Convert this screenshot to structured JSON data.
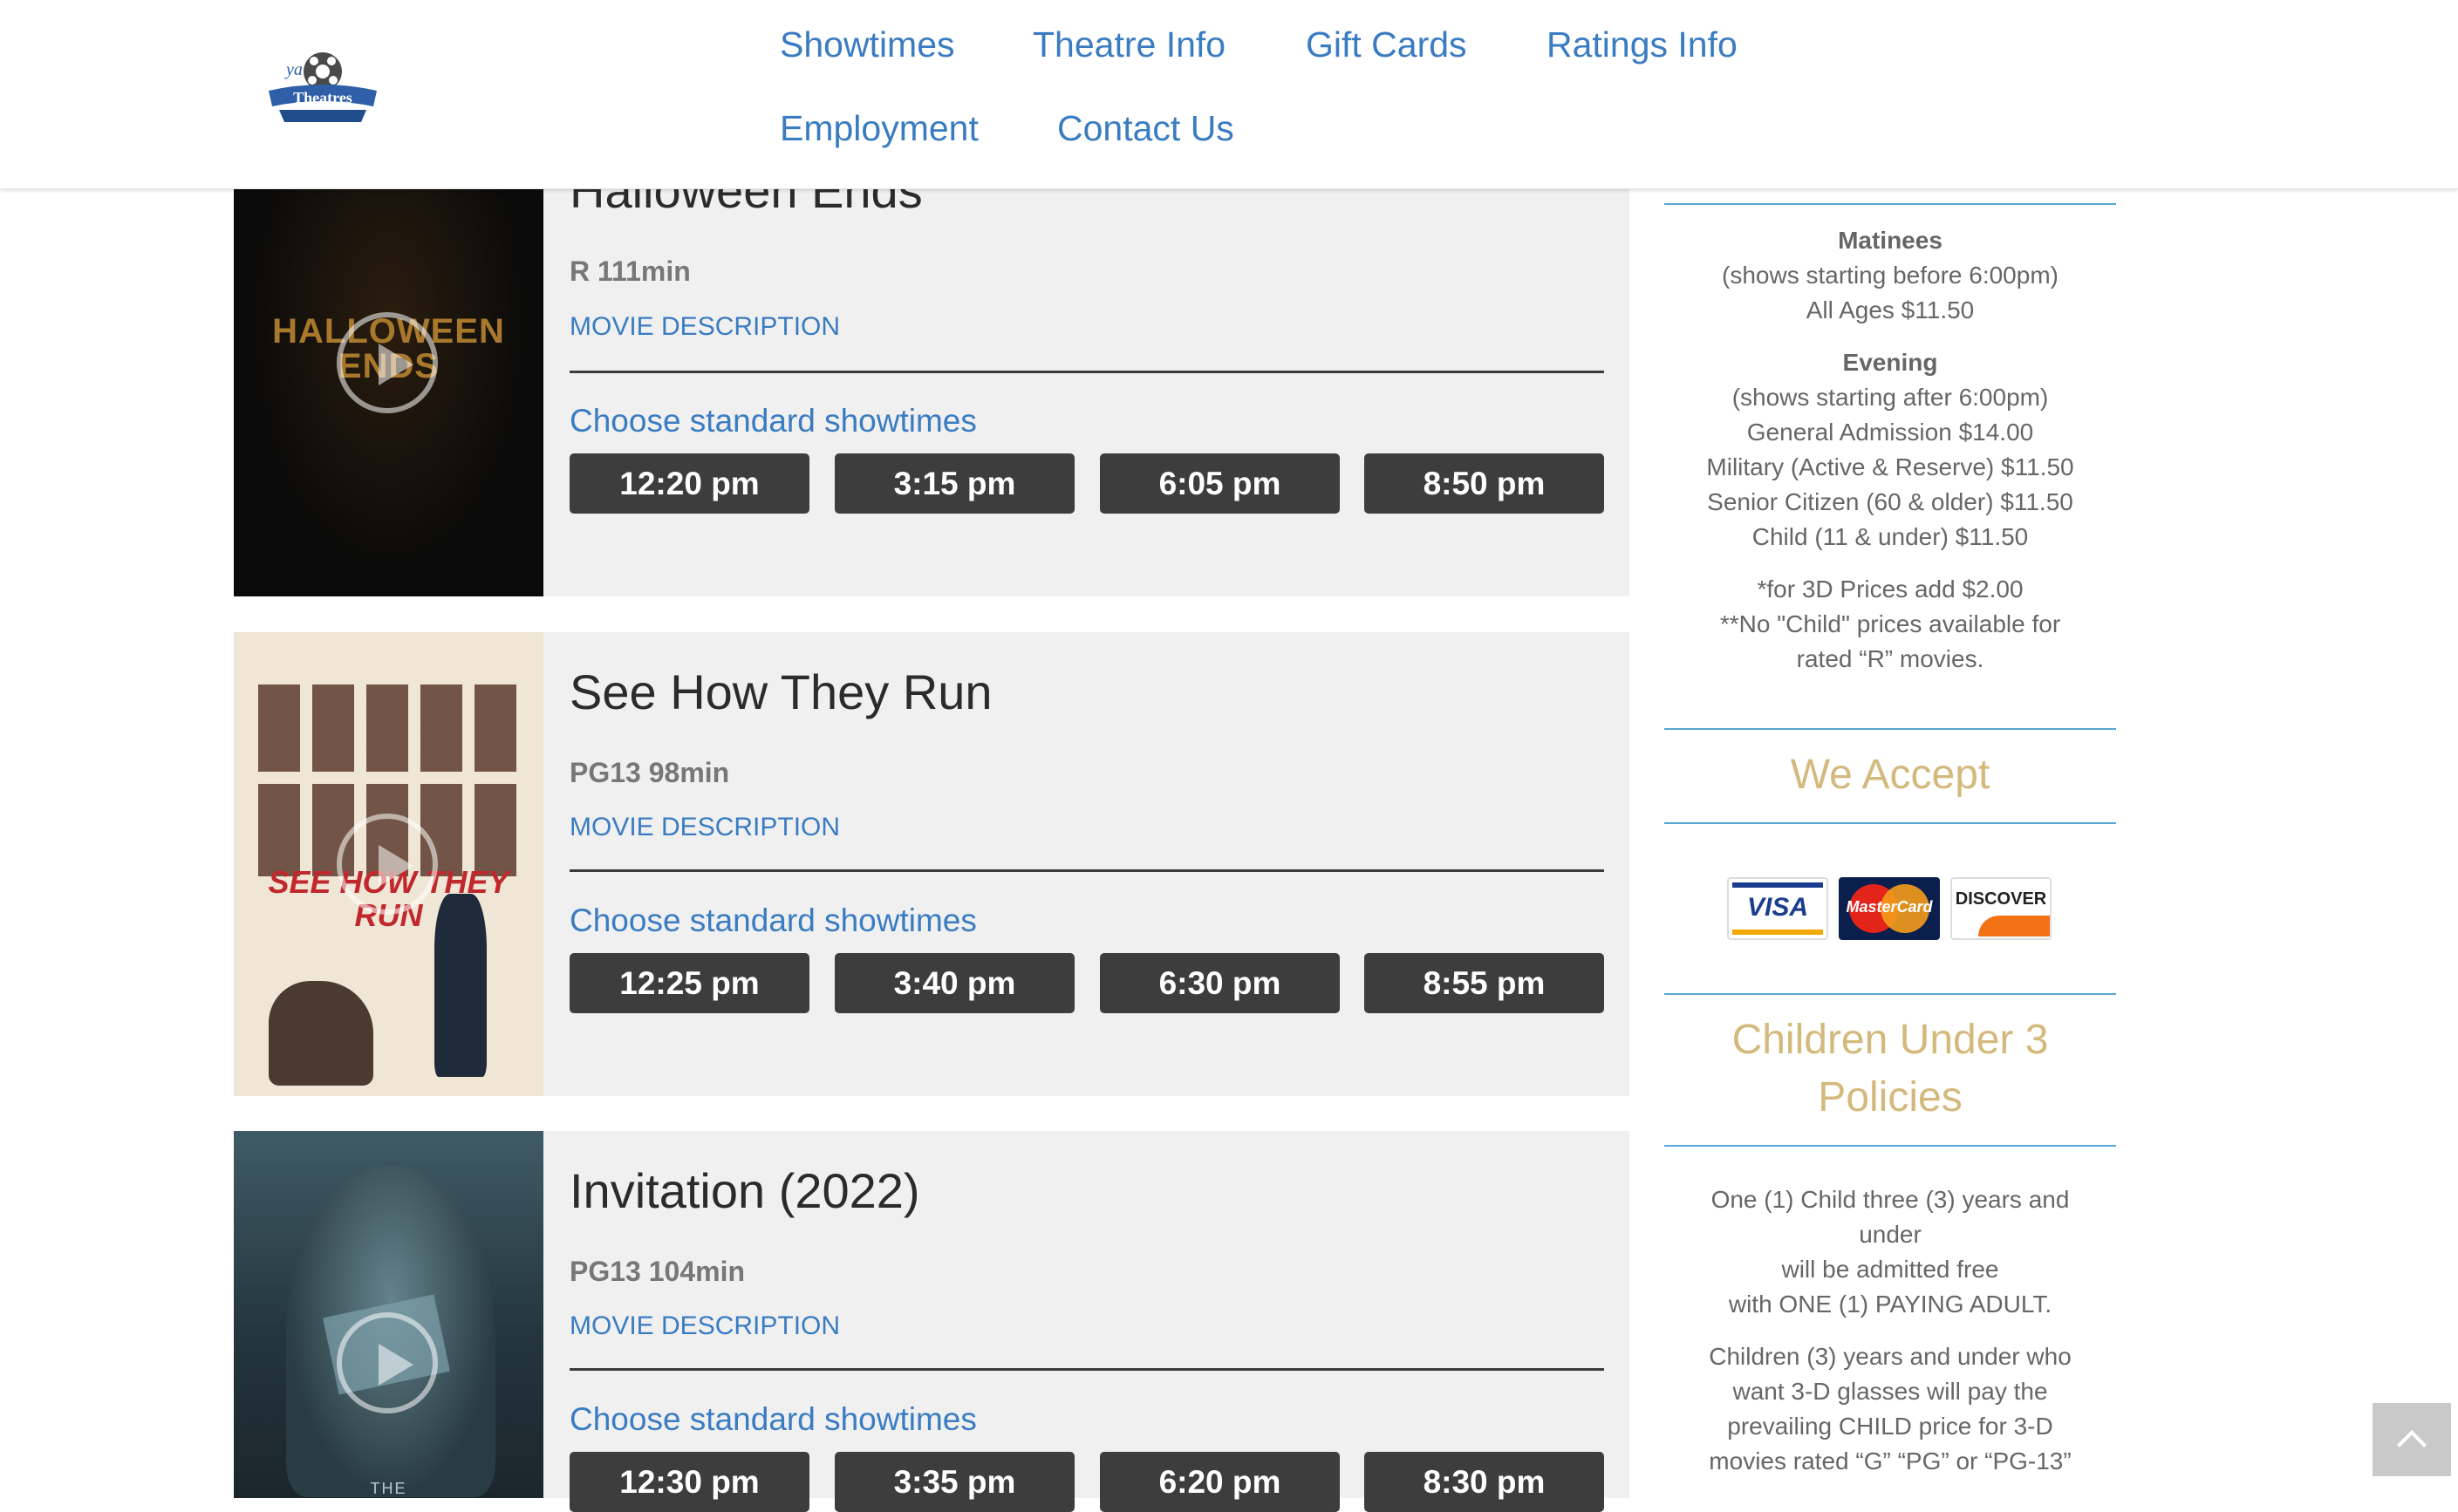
{
  "nav": {
    "items": [
      "Showtimes",
      "Theatre Info",
      "Gift Cards",
      "Ratings Info",
      "Employment",
      "Contact Us"
    ]
  },
  "logo": {
    "icon": "film-reel-logo",
    "text": "Theatres",
    "brand_color": "#2f5fa8"
  },
  "movies": [
    {
      "title": "Halloween Ends",
      "rating": "R 111min",
      "poster_text": "HALLOWEEN ENDS",
      "description_link": "MOVIE DESCRIPTION",
      "choose_label": "Choose standard showtimes",
      "showtimes": [
        "12:20 pm",
        "3:15 pm",
        "6:05 pm",
        "8:50 pm"
      ]
    },
    {
      "title": "See How They Run",
      "rating": "PG13 98min",
      "poster_text": "SEE HOW THEY RUN",
      "description_link": "MOVIE DESCRIPTION",
      "choose_label": "Choose standard showtimes",
      "showtimes": [
        "12:25 pm",
        "3:40 pm",
        "6:30 pm",
        "8:55 pm"
      ]
    },
    {
      "title": "Invitation (2022)",
      "rating": "PG13 104min",
      "poster_text": "THE",
      "description_link": "MOVIE DESCRIPTION",
      "choose_label": "Choose standard showtimes",
      "showtimes": [
        "12:30 pm",
        "3:35 pm",
        "6:20 pm",
        "8:30 pm"
      ]
    }
  ],
  "sidebar": {
    "matinees_title": "Matinees",
    "matinees_lines": [
      "(shows starting before 6:00pm)",
      "All Ages $11.50"
    ],
    "evening_title": "Evening",
    "evening_lines": [
      "(shows starting after 6:00pm)",
      "General Admission $14.00",
      "Military (Active & Reserve) $11.50",
      "Senior Citizen (60 & older) $11.50",
      "Child (11 & under) $11.50"
    ],
    "notes": [
      "*for 3D Prices add $2.00",
      "**No \"Child\" prices available for",
      "rated “R” movies."
    ],
    "accept_heading": "We Accept",
    "cards": [
      "VISA",
      "MasterCard",
      "DISCOVER"
    ],
    "children_heading_1": "Children Under 3",
    "children_heading_2": "Policies",
    "policy1": [
      "One (1) Child three (3) years and",
      "under",
      "will be admitted free",
      "with ONE (1) PAYING ADULT."
    ],
    "policy2": [
      "Children (3) years and under who",
      "want 3-D glasses will pay the",
      "prevailing CHILD price for 3-D",
      "movies rated “G” “PG” or “PG-13”"
    ]
  },
  "colors": {
    "link": "#3a7cc2",
    "accent_gold": "#d4b97d",
    "button_dark": "#3d3d3d",
    "card_bg": "#f0f0f0"
  }
}
